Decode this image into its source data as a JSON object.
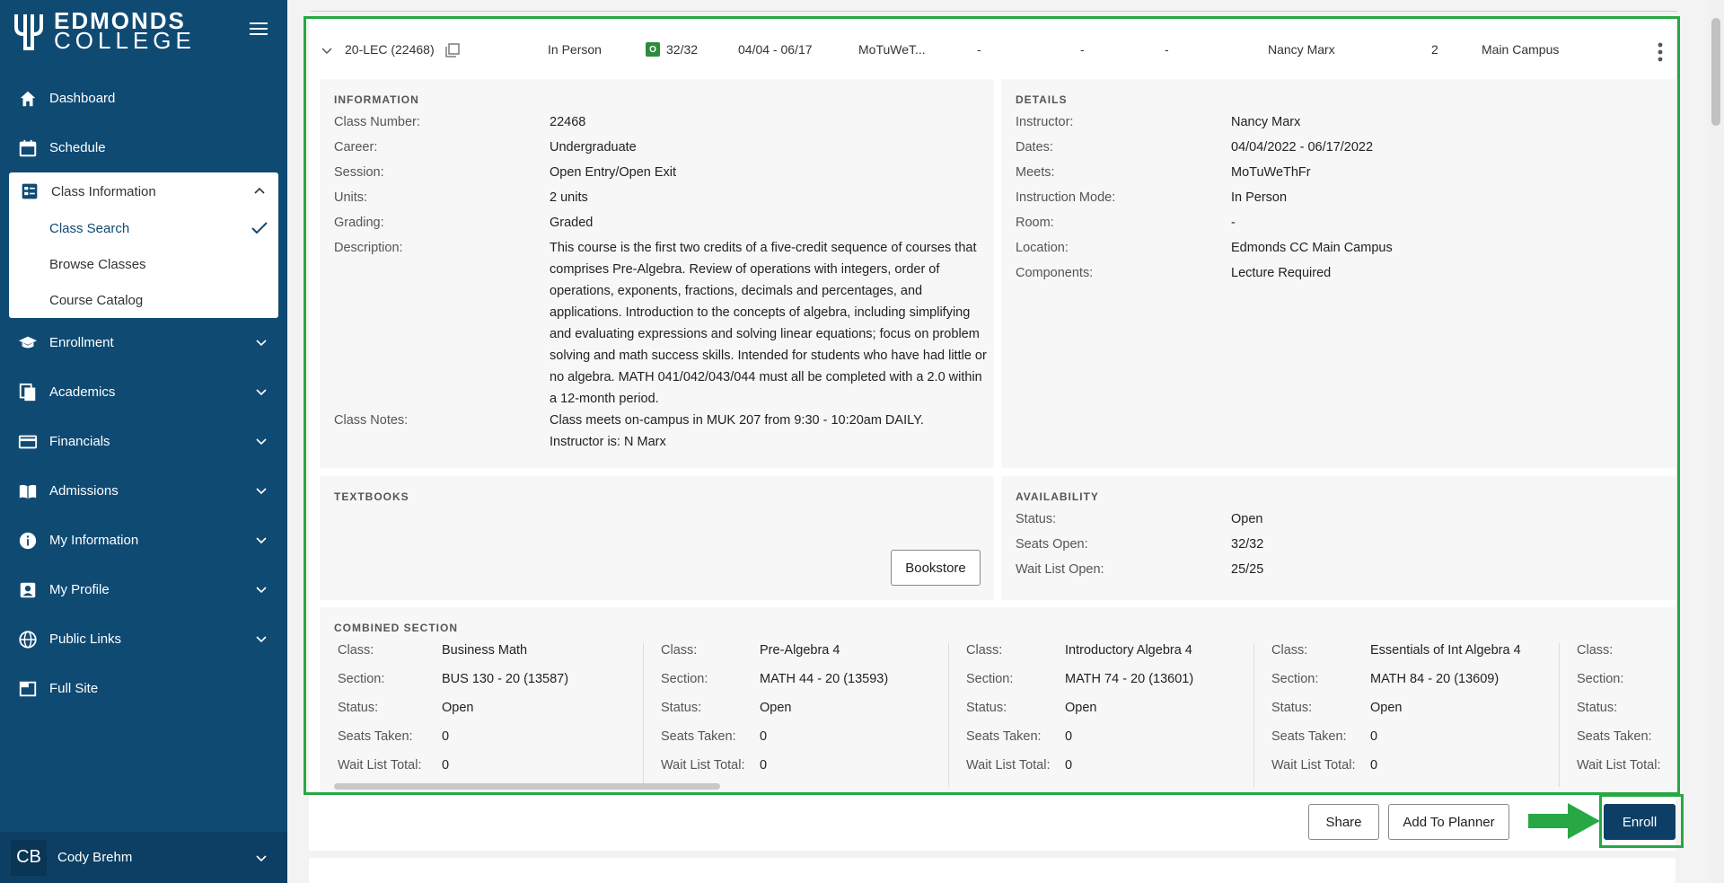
{
  "brand": {
    "line1": "EDMONDS",
    "line2": "COLLEGE"
  },
  "nav": {
    "dashboard": "Dashboard",
    "schedule": "Schedule",
    "class_information": "Class Information",
    "class_search": "Class Search",
    "browse_classes": "Browse Classes",
    "course_catalog": "Course Catalog",
    "enrollment": "Enrollment",
    "academics": "Academics",
    "financials": "Financials",
    "admissions": "Admissions",
    "my_information": "My Information",
    "my_profile": "My Profile",
    "public_links": "Public Links",
    "full_site": "Full Site"
  },
  "user": {
    "initials": "CB",
    "name": "Cody Brehm"
  },
  "section_row": {
    "section": "20-LEC (22468)",
    "mode": "In Person",
    "badge": "O",
    "seats": "32/32",
    "dates": "04/04 - 06/17",
    "days": "MoTuWeT...",
    "c1": "-",
    "c2": "-",
    "c3": "-",
    "instructor": "Nancy Marx",
    "units": "2",
    "campus": "Main Campus"
  },
  "information": {
    "title": "INFORMATION",
    "class_number_label": "Class Number:",
    "class_number": "22468",
    "career_label": "Career:",
    "career": "Undergraduate",
    "session_label": "Session:",
    "session": "Open Entry/Open Exit",
    "units_label": "Units:",
    "units": "2 units",
    "grading_label": "Grading:",
    "grading": "Graded",
    "description_label": "Description:",
    "description": "This course is the first two credits of a five-credit sequence of courses that comprises Pre-Algebra. Review of operations with integers, order of operations, exponents, fractions, decimals and percentages, and applications. Introduction to the concepts of algebra, including simplifying and evaluating expressions and solving linear equations; focus on problem solving and math success skills. Intended for students who have had little or no algebra. MATH 041/042/043/044 must all be completed with a 2.0 within a 12-month period.",
    "notes_label": "Class Notes:",
    "notes_line1": "Class meets on-campus in MUK 207 from 9:30 - 10:20am DAILY.",
    "notes_line2": "Instructor is: N Marx"
  },
  "details": {
    "title": "DETAILS",
    "instructor_label": "Instructor:",
    "instructor": "Nancy Marx",
    "dates_label": "Dates:",
    "dates": "04/04/2022 - 06/17/2022",
    "meets_label": "Meets:",
    "meets": "MoTuWeThFr",
    "mode_label": "Instruction Mode:",
    "mode": "In Person",
    "room_label": "Room:",
    "room": "-",
    "location_label": "Location:",
    "location": "Edmonds CC Main Campus",
    "components_label": "Components:",
    "components": "Lecture Required"
  },
  "textbooks": {
    "title": "TEXTBOOKS",
    "bookstore": "Bookstore"
  },
  "availability": {
    "title": "AVAILABILITY",
    "status_label": "Status:",
    "status": "Open",
    "seats_label": "Seats Open:",
    "seats": "32/32",
    "waitlist_label": "Wait List Open:",
    "waitlist": "25/25"
  },
  "combined": {
    "title": "COMBINED SECTION",
    "labels": {
      "class": "Class:",
      "section": "Section:",
      "status": "Status:",
      "taken": "Seats Taken:",
      "wait": "Wait List Total:"
    },
    "sections": [
      {
        "class": "Business Math",
        "section": "BUS 130 - 20 (13587)",
        "status": "Open",
        "taken": "0",
        "wait": "0"
      },
      {
        "class": "Pre-Algebra 4",
        "section": "MATH 44 - 20 (13593)",
        "status": "Open",
        "taken": "0",
        "wait": "0"
      },
      {
        "class": "Introductory Algebra 4",
        "section": "MATH 74 - 20 (13601)",
        "status": "Open",
        "taken": "0",
        "wait": "0"
      },
      {
        "class": "Essentials of Int Algebra 4",
        "section": "MATH 84 - 20 (13609)",
        "status": "Open",
        "taken": "0",
        "wait": "0"
      }
    ]
  },
  "actions": {
    "share": "Share",
    "planner": "Add To Planner",
    "enroll": "Enroll"
  },
  "colors": {
    "sidebar": "#0f4a73",
    "highlight": "#27a844",
    "primary": "#0d3f66"
  }
}
